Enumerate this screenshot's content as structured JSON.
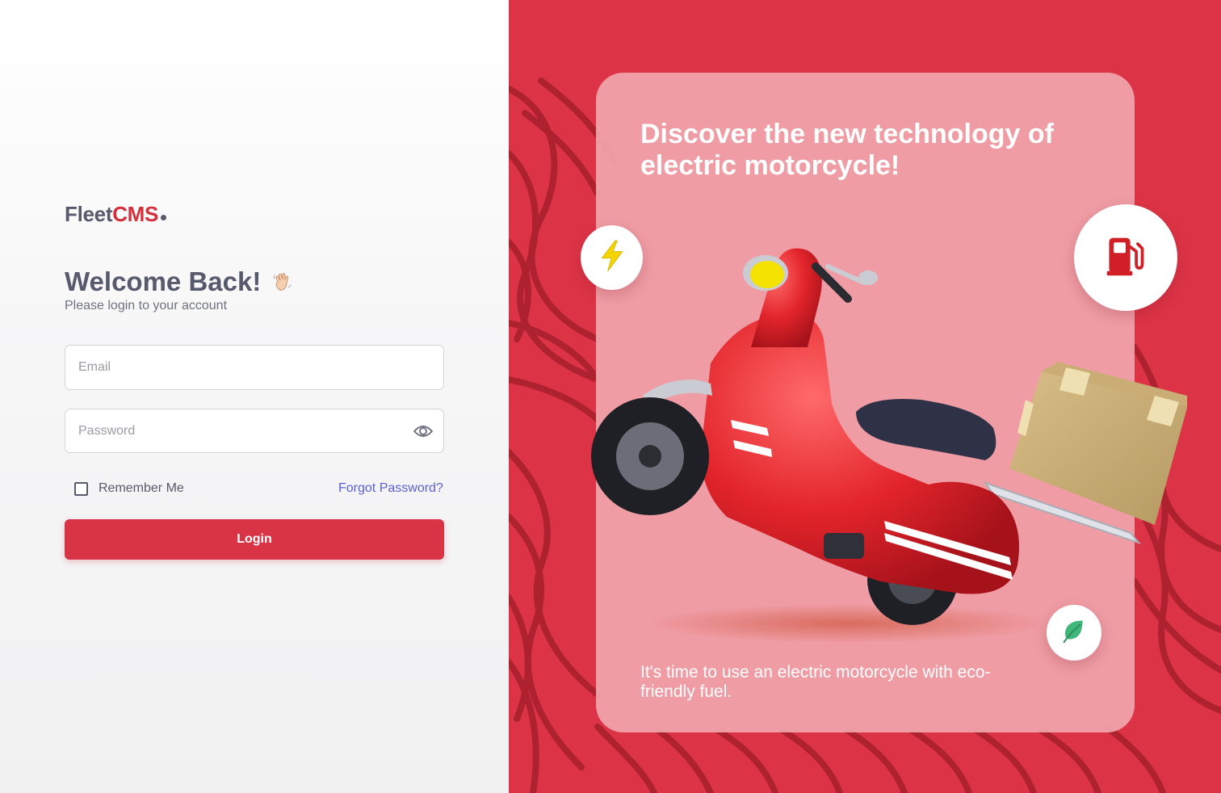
{
  "brand": {
    "part1": "Fleet",
    "part2": "CMS"
  },
  "login": {
    "heading": "Welcome Back!",
    "subtitle": "Please login to your account",
    "email_placeholder": "Email",
    "password_placeholder": "Password",
    "remember_label": "Remember Me",
    "forgot_label": "Forgot Password?",
    "login_label": "Login"
  },
  "promo": {
    "headline": "Discover the new technology of electric motorcycle!",
    "tagline": "It's time to use an electric motorcycle with eco-friendly fuel."
  },
  "icons": {
    "wave": "waving-hand-icon",
    "eye": "eye-icon",
    "bolt": "lightning-bolt-icon",
    "fuel": "fuel-pump-icon",
    "leaf": "leaf-icon"
  },
  "colors": {
    "brand_red": "#d93446",
    "panel_red": "#dc3446",
    "card_pink": "#efa0a8",
    "text_dark": "#575a6c",
    "link_blue": "#5b5fd6",
    "leaf_green": "#3fb67a",
    "bolt_yellow": "#f4d400"
  }
}
